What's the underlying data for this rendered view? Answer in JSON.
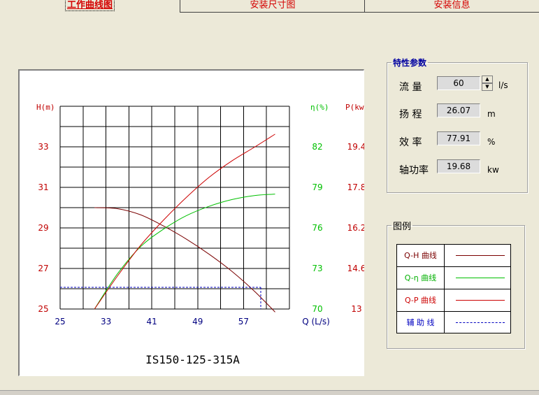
{
  "tabs": [
    {
      "label": "工作曲线图",
      "active": true
    },
    {
      "label": "安装尺寸图",
      "active": false
    },
    {
      "label": "安装信息",
      "active": false
    }
  ],
  "params": {
    "title": "特性参数",
    "flow": {
      "label": "流  量",
      "value": "60",
      "unit": "l/s"
    },
    "head": {
      "label": "扬  程",
      "value": "26.07",
      "unit": "m"
    },
    "efficiency": {
      "label": "效  率",
      "value": "77.91",
      "unit": "%"
    },
    "power": {
      "label": "轴功率",
      "value": "19.68",
      "unit": "kw"
    }
  },
  "legend": {
    "title": "图例",
    "items": [
      {
        "label": "Q-H 曲线",
        "color": "#7a0000",
        "style": "solid"
      },
      {
        "label": "Q-η 曲线",
        "color": "#00c000",
        "style": "solid"
      },
      {
        "label": "Q-P 曲线",
        "color": "#cc0000",
        "style": "solid"
      },
      {
        "label": "辅 助 线",
        "color": "#0000c0",
        "style": "dashed"
      }
    ]
  },
  "chart_data": {
    "type": "line",
    "title": "IS150-125-315A",
    "xlabel": "Q (L/s)",
    "x_ticks": [
      "25",
      "33",
      "41",
      "49",
      "57"
    ],
    "xlim": [
      25,
      65
    ],
    "y_axes": [
      {
        "label": "H(m)",
        "ticks": [
          "33",
          "31",
          "29",
          "27",
          "25"
        ],
        "range": [
          25,
          35
        ],
        "color": "#c00000"
      },
      {
        "label": "η(%)",
        "ticks": [
          "82",
          "79",
          "76",
          "73",
          "70"
        ],
        "range": [
          70,
          85
        ],
        "color": "#00c000"
      },
      {
        "label": "P(kw.h)",
        "ticks": [
          "19.4",
          "17.8",
          "16.2",
          "14.6",
          "13"
        ],
        "range": [
          13,
          21
        ],
        "color": "#c00000"
      }
    ],
    "grid": true,
    "series": [
      {
        "name": "Q-H 曲线",
        "axis": 0,
        "color": "#7a0000",
        "x": [
          31,
          35,
          39,
          43,
          47,
          51,
          55,
          59,
          62.5
        ],
        "y": [
          30.0,
          29.95,
          29.65,
          29.1,
          28.45,
          27.7,
          26.85,
          25.85,
          24.85
        ]
      },
      {
        "name": "Q-η 曲线",
        "axis": 1,
        "color": "#00c000",
        "x": [
          31,
          35,
          39,
          43,
          47,
          51,
          55,
          59,
          62.5
        ],
        "y": [
          70.0,
          72.6,
          74.6,
          75.9,
          76.9,
          77.6,
          78.1,
          78.4,
          78.5
        ]
      },
      {
        "name": "Q-P 曲线",
        "axis": 2,
        "color": "#cc0000",
        "x": [
          31,
          35,
          39,
          43,
          47,
          51,
          55,
          59,
          62.5
        ],
        "y": [
          13.0,
          14.3,
          15.5,
          16.5,
          17.4,
          18.2,
          18.85,
          19.4,
          19.9
        ]
      }
    ],
    "auxiliary": {
      "name": "辅助线",
      "color": "#0000c0",
      "q": 60,
      "h": 26.07
    }
  }
}
